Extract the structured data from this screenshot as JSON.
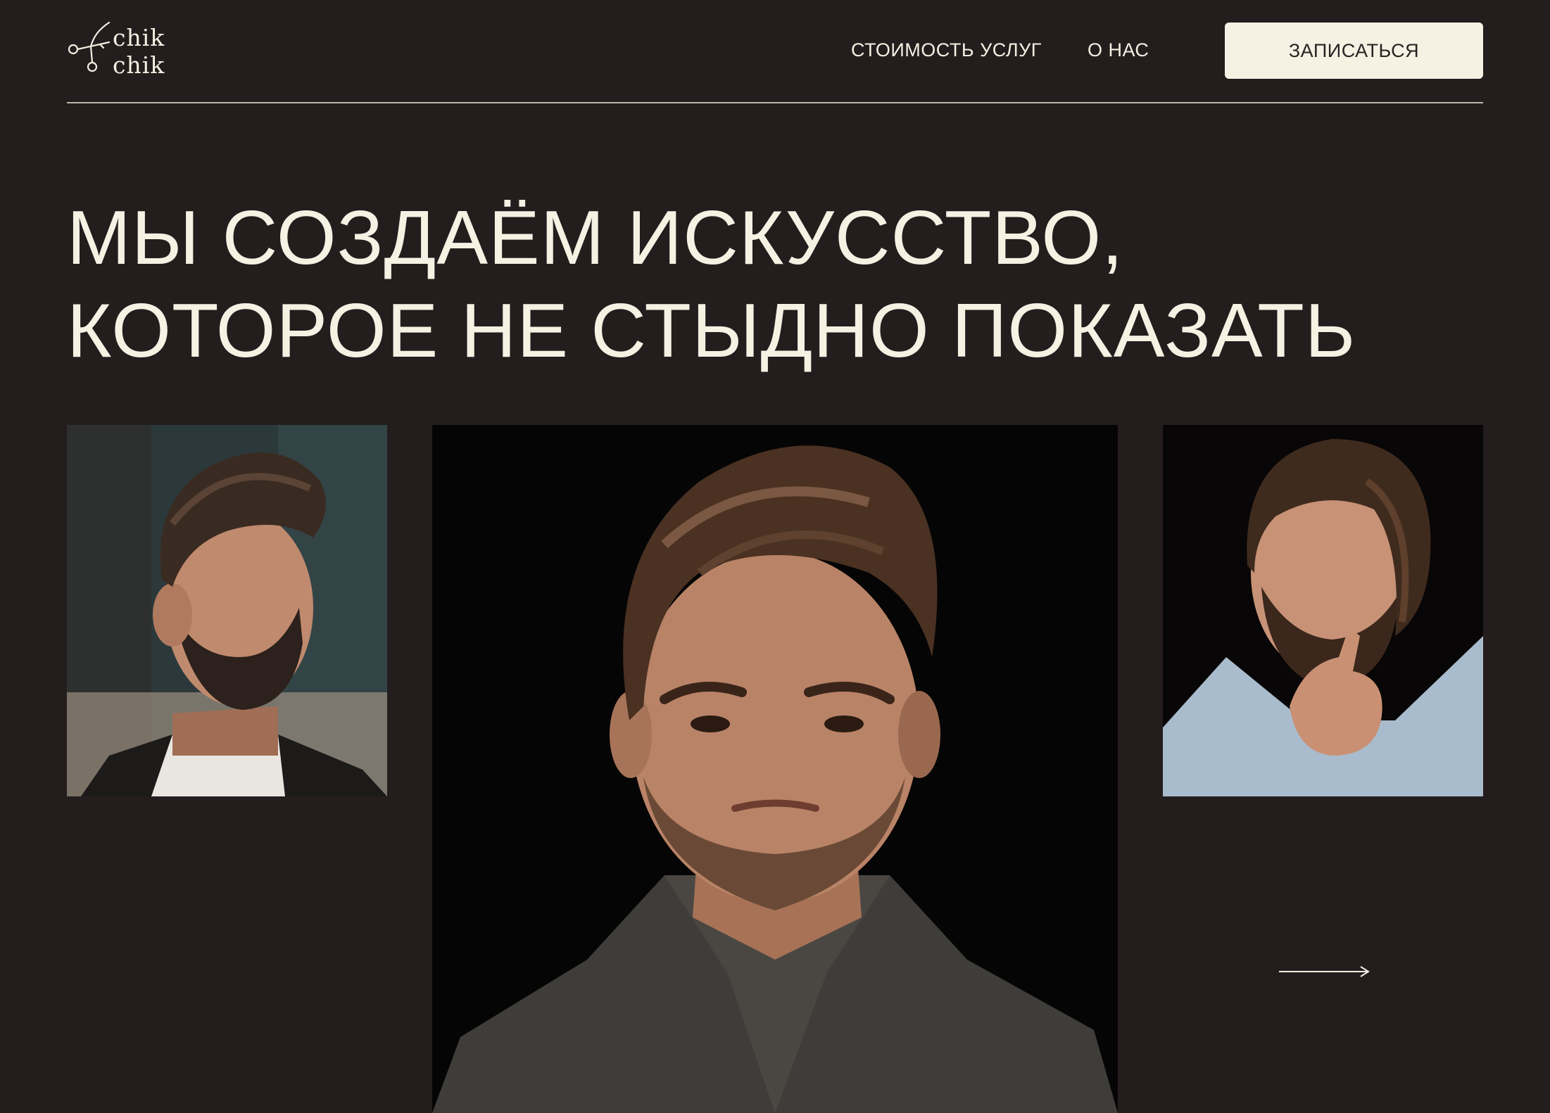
{
  "brand": {
    "logo_line1": "chik",
    "logo_line2": "chik"
  },
  "nav": {
    "prices_label": "СТОИМОСТЬ УСЛУГ",
    "about_label": "О НАС",
    "cta_label": "ЗАПИСАТЬСЯ"
  },
  "hero": {
    "title_line1": "МЫ СОЗДАЁМ ИСКУССТВО,",
    "title_line2": "КОТОРОЕ НЕ СТЫДНО ПОКАЗАТЬ"
  },
  "gallery": {
    "photos": [
      {
        "subject": "man-with-quiff-and-beard-photo"
      },
      {
        "subject": "man-with-brown-hair-in-knit-sweater-photo"
      },
      {
        "subject": "bearded-man-thinking-photo"
      }
    ],
    "next_icon": "arrow-right-icon"
  },
  "colors": {
    "background": "#241d1d",
    "text": "#f5f1e3",
    "button_bg": "#f5f1e3",
    "button_text": "#2a2222"
  }
}
